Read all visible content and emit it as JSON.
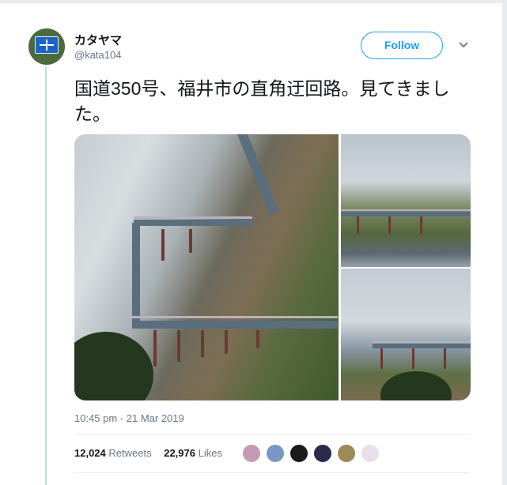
{
  "user": {
    "display_name": "カタヤマ",
    "handle": "@kata104"
  },
  "follow_label": "Follow",
  "tweet": {
    "text": "国道350号、福井市の直角迂回路。見てきました。",
    "timestamp": "10:45 pm - 21 Mar 2019"
  },
  "stats": {
    "retweets_count": "12,024",
    "retweets_label": "Retweets",
    "likes_count": "22,976",
    "likes_label": "Likes"
  },
  "likers": [
    {
      "icon": "liker-avatar",
      "color": "#c59ab3"
    },
    {
      "icon": "liker-avatar",
      "color": "#7a97c7"
    },
    {
      "icon": "liker-avatar",
      "color": "#1b1b1b"
    },
    {
      "icon": "liker-avatar",
      "color": "#2a2a4a"
    },
    {
      "icon": "liker-avatar",
      "color": "#9c8a57"
    },
    {
      "icon": "liker-avatar",
      "color": "#e8e0ea"
    }
  ],
  "colors": {
    "accent": "#1da1f2",
    "text": "#14171a",
    "muted": "#657786",
    "thread_line": "#b6dcf5"
  }
}
